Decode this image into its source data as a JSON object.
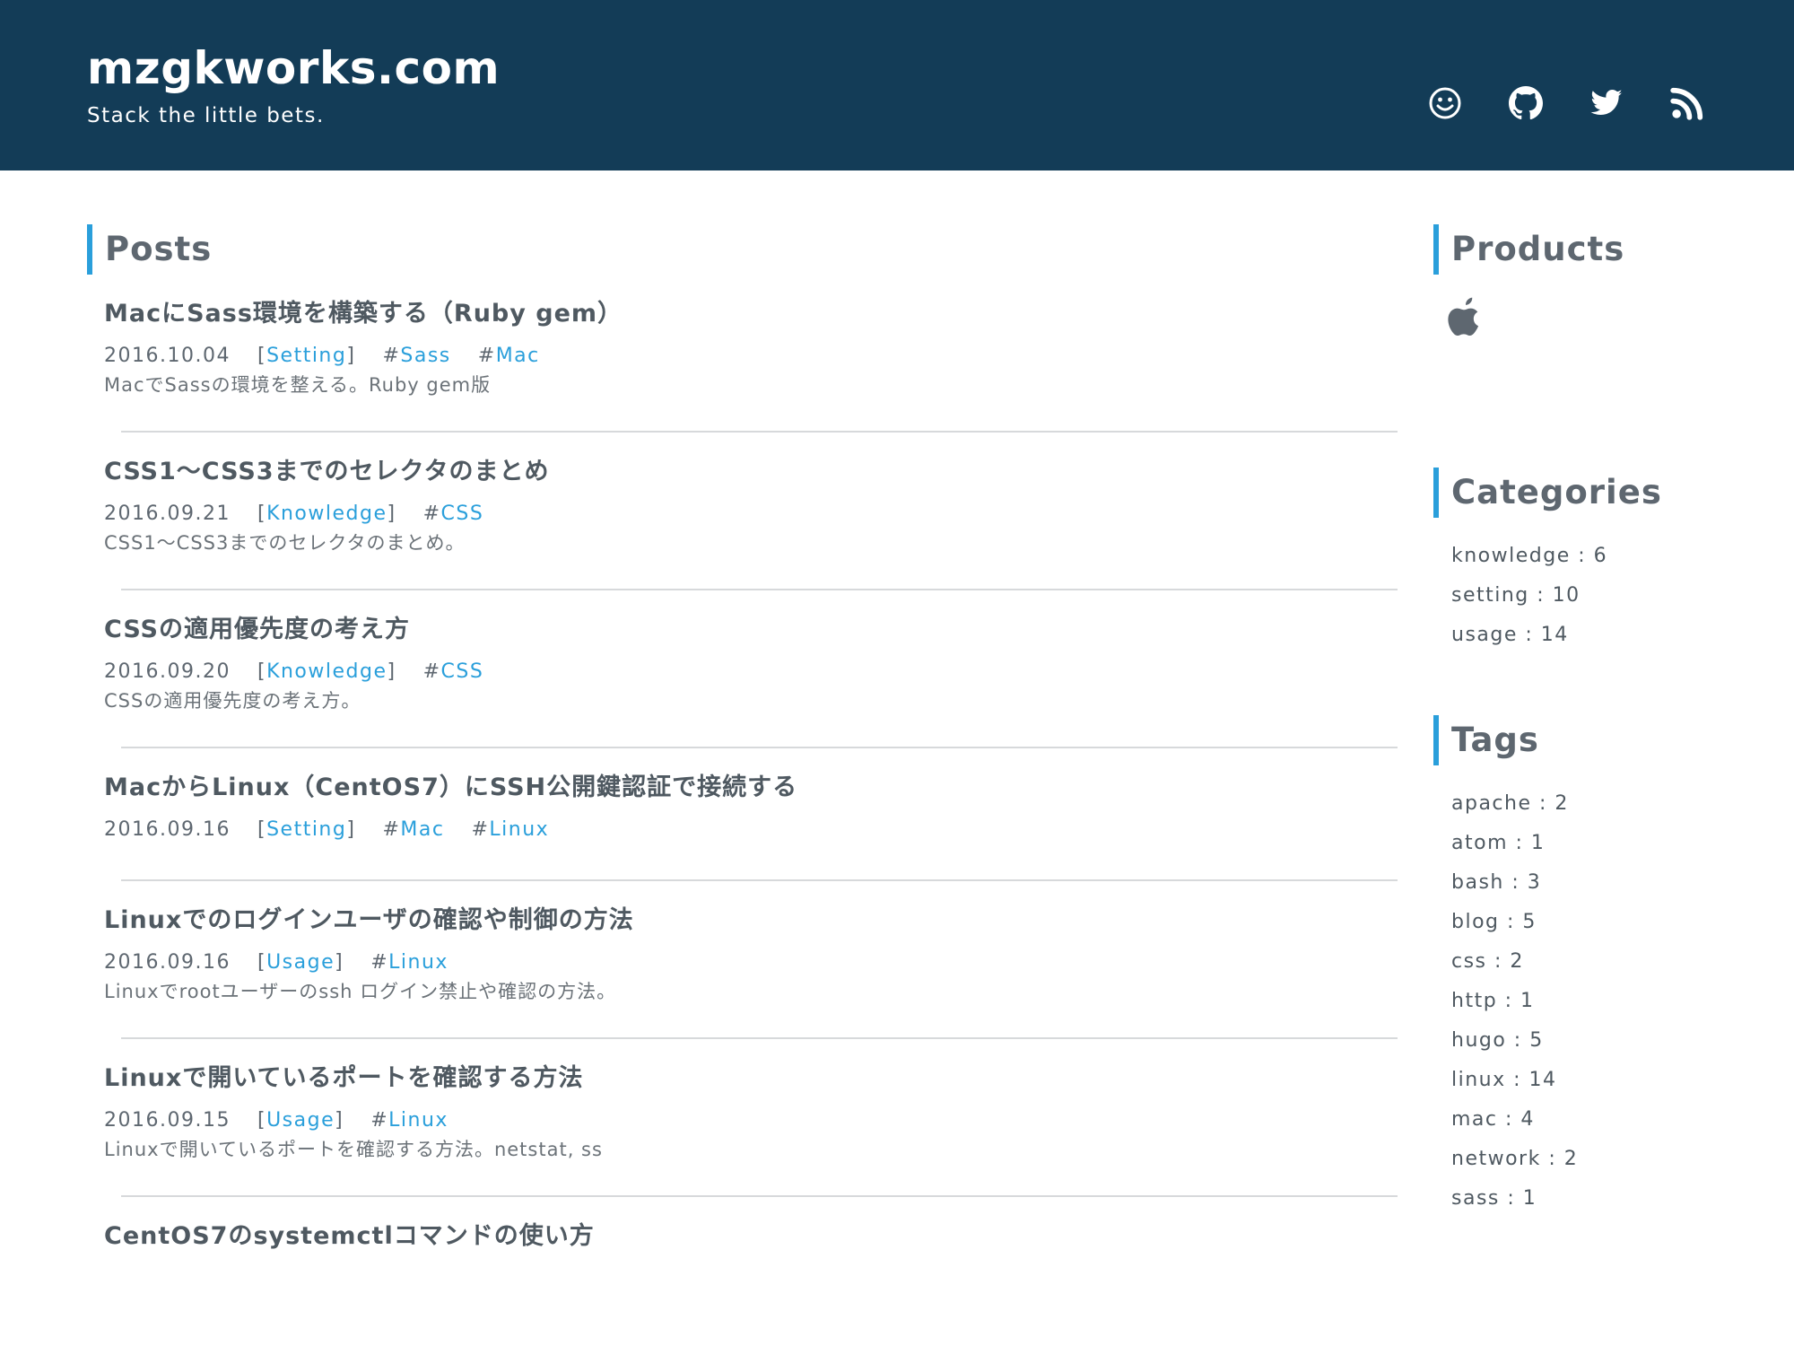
{
  "site": {
    "title": "mzgkworks.com",
    "tagline": "Stack the little bets."
  },
  "header_icons": [
    "smile-icon",
    "github-icon",
    "twitter-icon",
    "rss-icon"
  ],
  "colors": {
    "header_bg": "#133c57",
    "accent": "#2a9fdb",
    "text": "#555b61",
    "divider": "#d7d9db"
  },
  "posts_heading": "Posts",
  "posts": [
    {
      "title": "MacにSass環境を構築する（Ruby gem）",
      "date": "2016.10.04",
      "category": "Setting",
      "tags": [
        "Sass",
        "Mac"
      ],
      "summary": "MacでSassの環境を整える。Ruby gem版"
    },
    {
      "title": "CSS1〜CSS3までのセレクタのまとめ",
      "date": "2016.09.21",
      "category": "Knowledge",
      "tags": [
        "CSS"
      ],
      "summary": "CSS1〜CSS3までのセレクタのまとめ。"
    },
    {
      "title": "CSSの適用優先度の考え方",
      "date": "2016.09.20",
      "category": "Knowledge",
      "tags": [
        "CSS"
      ],
      "summary": "CSSの適用優先度の考え方。"
    },
    {
      "title": "MacからLinux（CentOS7）にSSH公開鍵認証で接続する",
      "date": "2016.09.16",
      "category": "Setting",
      "tags": [
        "Mac",
        "Linux"
      ],
      "summary": ""
    },
    {
      "title": "Linuxでのログインユーザの確認や制御の方法",
      "date": "2016.09.16",
      "category": "Usage",
      "tags": [
        "Linux"
      ],
      "summary": "Linuxでrootユーザーのssh ログイン禁止や確認の方法。"
    },
    {
      "title": "Linuxで開いているポートを確認する方法",
      "date": "2016.09.15",
      "category": "Usage",
      "tags": [
        "Linux"
      ],
      "summary": "Linuxで開いているポートを確認する方法。netstat, ss"
    },
    {
      "title": "CentOS7のsystemctlコマンドの使い方",
      "date": "",
      "category": "",
      "tags": [],
      "summary": ""
    }
  ],
  "sidebar": {
    "products_heading": "Products",
    "product_icons": [
      "apple-icon"
    ],
    "categories_heading": "Categories",
    "categories": [
      "knowledge : 6",
      "setting : 10",
      "usage : 14"
    ],
    "tags_heading": "Tags",
    "tags": [
      "apache : 2",
      "atom : 1",
      "bash : 3",
      "blog : 5",
      "css : 2",
      "http : 1",
      "hugo : 5",
      "linux : 14",
      "mac : 4",
      "network : 2",
      "sass : 1"
    ]
  }
}
